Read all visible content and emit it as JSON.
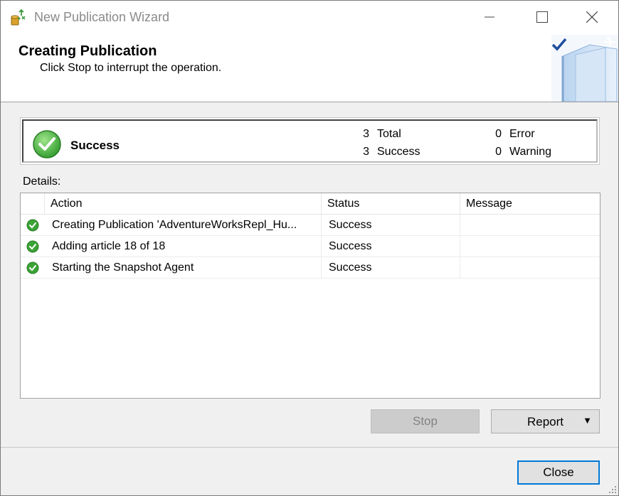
{
  "window": {
    "title": "New Publication Wizard",
    "icon": "publication-wizard-icon"
  },
  "header": {
    "title": "Creating Publication",
    "subtitle": "Click Stop to interrupt the operation."
  },
  "summary": {
    "status": "Success",
    "total_count": "3",
    "total_label": "Total",
    "success_count": "3",
    "success_label": "Success",
    "error_count": "0",
    "error_label": "Error",
    "warning_count": "0",
    "warning_label": "Warning"
  },
  "details": {
    "label": "Details:",
    "columns": [
      "Action",
      "Status",
      "Message"
    ],
    "rows": [
      {
        "action": "Creating Publication 'AdventureWorksRepl_Hu...",
        "status": "Success",
        "message": ""
      },
      {
        "action": "Adding article 18 of 18",
        "status": "Success",
        "message": ""
      },
      {
        "action": "Starting the Snapshot Agent",
        "status": "Success",
        "message": ""
      }
    ]
  },
  "buttons": {
    "stop": "Stop",
    "report": "Report",
    "close": "Close"
  },
  "colors": {
    "success_green": "#3aa335",
    "focus_blue": "#0078d7"
  }
}
